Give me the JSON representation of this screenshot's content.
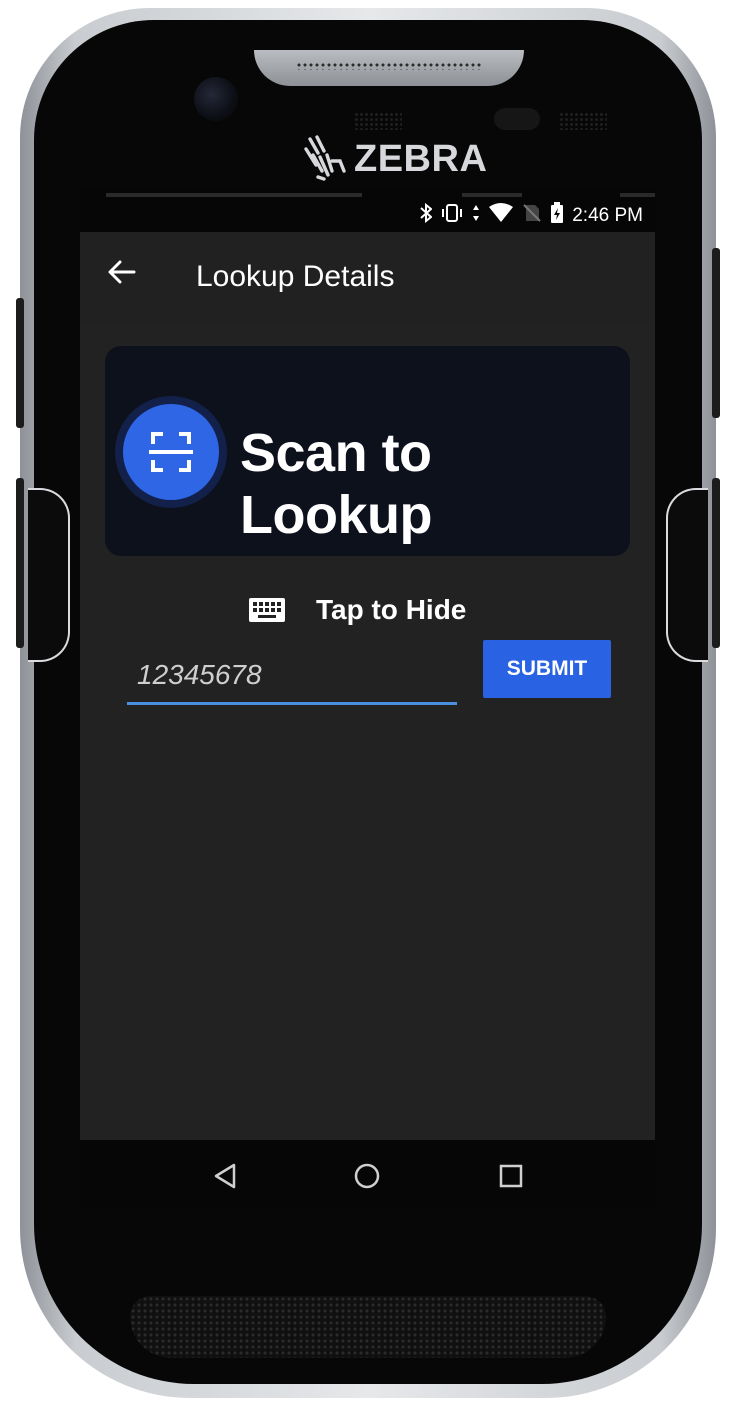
{
  "device": {
    "brand": "ZEBRA"
  },
  "status_bar": {
    "time": "2:46 PM",
    "icons": [
      "bluetooth-icon",
      "vibrate-icon",
      "wifi-icon",
      "no-sim-icon",
      "battery-charging-icon"
    ]
  },
  "app_bar": {
    "back_icon": "arrow-left-icon",
    "title": "Lookup Details"
  },
  "scan_card": {
    "icon": "barcode-scan-icon",
    "label": "Scan to Lookup"
  },
  "keyboard_toggle": {
    "icon": "keyboard-icon",
    "label": "Tap to Hide"
  },
  "lookup_input": {
    "value": "12345678"
  },
  "submit_button": {
    "label": "SUBMIT"
  },
  "nav_bar": {
    "buttons": [
      "back-icon",
      "home-icon",
      "recents-icon"
    ]
  },
  "colors": {
    "accent": "#2a62e4",
    "app_background": "#222222",
    "card_background": "#0d111c",
    "input_underline": "#4a8fe0"
  }
}
